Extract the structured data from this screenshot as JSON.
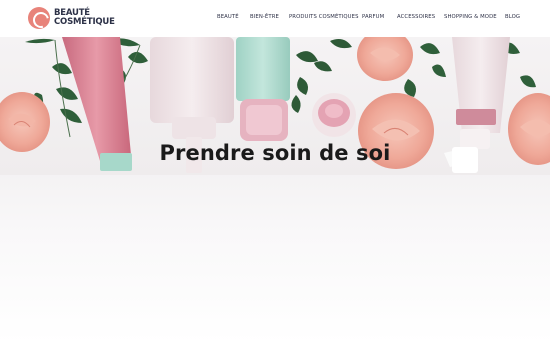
{
  "brand": {
    "line1": "BEAUTÉ",
    "line2": "COSMÉTIQUE",
    "accent_color": "#e8837a",
    "text_color": "#2c3147"
  },
  "nav": {
    "items": [
      {
        "label": "BEAUTÉ"
      },
      {
        "label": "BIEN-ÊTRE"
      },
      {
        "label": "PRODUITS COSMÉTIQUES"
      },
      {
        "label": "PARFUM"
      },
      {
        "label": "ACCESSOIRES"
      },
      {
        "label": "SHOPPING & MODE"
      },
      {
        "label": "BLOG"
      }
    ]
  },
  "hero": {
    "title": "Prendre soin de soi",
    "image_subject": "cosmetic-products-with-roses-and-leaves"
  }
}
